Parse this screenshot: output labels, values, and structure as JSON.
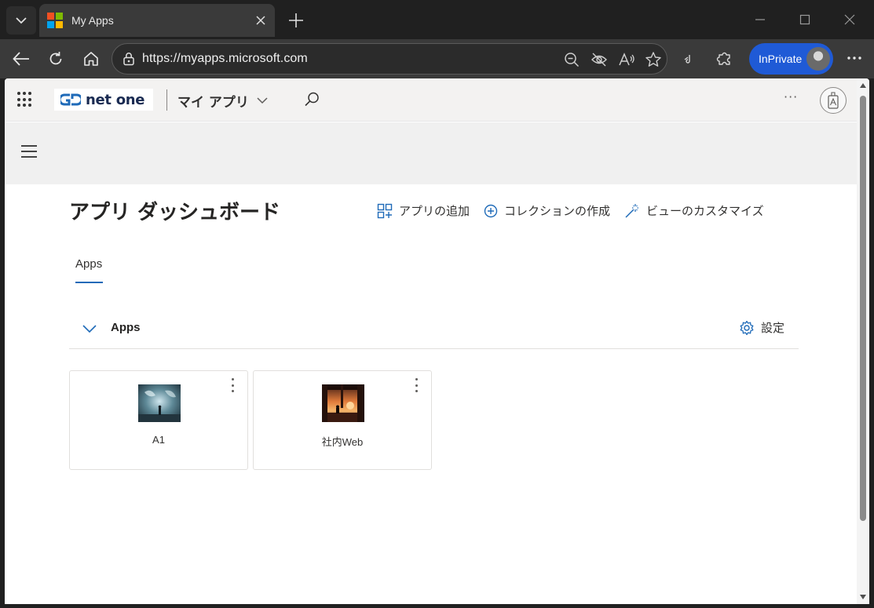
{
  "browser": {
    "tab_title": "My Apps",
    "url": "https://myapps.microsoft.com",
    "inprivate_label": "InPrivate",
    "favicon_colors": [
      "#f25022",
      "#7fba00",
      "#00a4ef",
      "#ffb900"
    ]
  },
  "header": {
    "brand_text": "net one",
    "app_title": "マイ アプリ"
  },
  "dashboard": {
    "title": "アプリ ダッシュボード",
    "actions": {
      "add_app": "アプリの追加",
      "create_collection": "コレクションの作成",
      "customize_view": "ビューのカスタマイズ"
    }
  },
  "tabs": [
    {
      "label": "Apps",
      "selected": true
    }
  ],
  "section": {
    "title": "Apps",
    "settings_label": "設定"
  },
  "apps": [
    {
      "label": "A1",
      "image": "stormy-figure-thumbnail"
    },
    {
      "label": "社内Web",
      "image": "sunset-room-thumbnail"
    }
  ],
  "colors": {
    "accent": "#1e6ab8",
    "inprivate": "#1f5ad6"
  }
}
